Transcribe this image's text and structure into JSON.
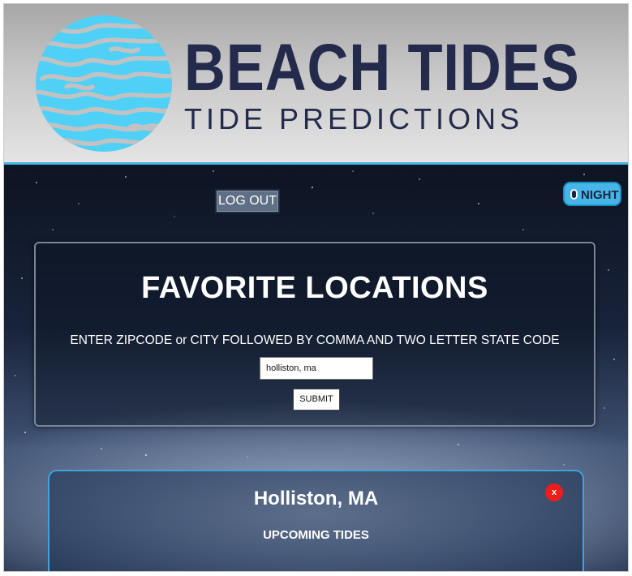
{
  "header": {
    "title": "BEACH TIDES",
    "subtitle": "TIDE PREDICTIONS",
    "logo_icon": "wave-globe-icon"
  },
  "toolbar": {
    "logout_label": "LOG OUT",
    "theme_toggle_label": "NIGHT"
  },
  "favorites": {
    "heading": "FAVORITE LOCATIONS",
    "instructions": "ENTER ZIPCODE or CITY FOLLOWED BY COMMA AND TWO LETTER STATE CODE",
    "input_value": "holliston, ma",
    "submit_label": "SUBMIT"
  },
  "locations": [
    {
      "name": "Holliston, MA",
      "subheading": "UPCOMING TIDES",
      "remove_label": "x"
    }
  ],
  "colors": {
    "brand_navy": "#232a4c",
    "accent_blue": "#43b4e2",
    "remove_red": "#ee1c1c"
  }
}
